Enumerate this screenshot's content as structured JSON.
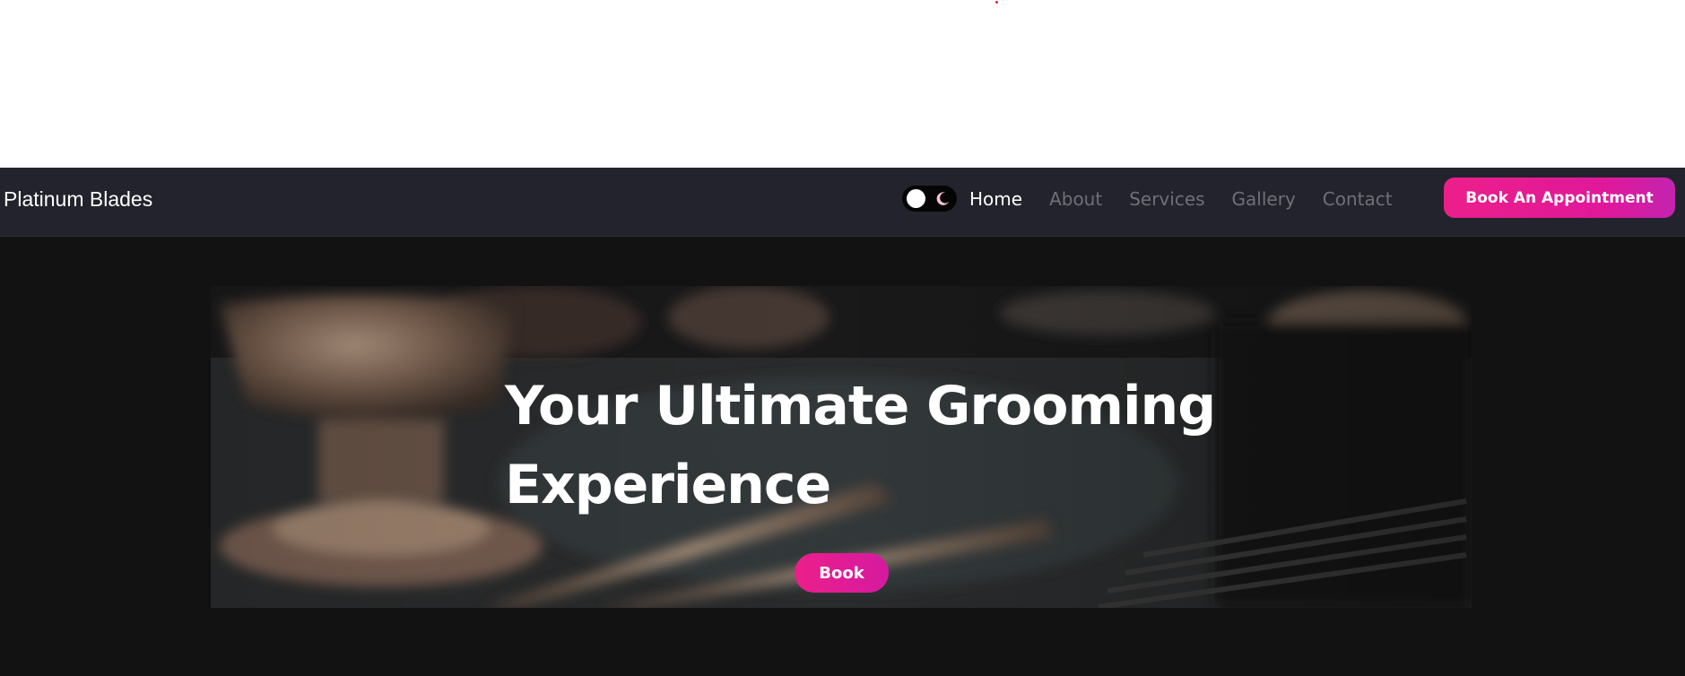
{
  "brand": {
    "name": "Platinum Blades"
  },
  "theme_toggle": {
    "state": "dark"
  },
  "nav": {
    "links": [
      {
        "label": "Home",
        "active": true
      },
      {
        "label": "About",
        "active": false
      },
      {
        "label": "Services",
        "active": false
      },
      {
        "label": "Gallery",
        "active": false
      },
      {
        "label": "Contact",
        "active": false
      }
    ],
    "cta_label": "Book An Appointment"
  },
  "hero": {
    "title_line1": "Your Ultimate Grooming",
    "title_line2": "Experience",
    "button_label": "Book"
  },
  "colors": {
    "accent": "#ec1f8a",
    "navbar_bg": "#23232d",
    "page_bg": "#121212"
  }
}
